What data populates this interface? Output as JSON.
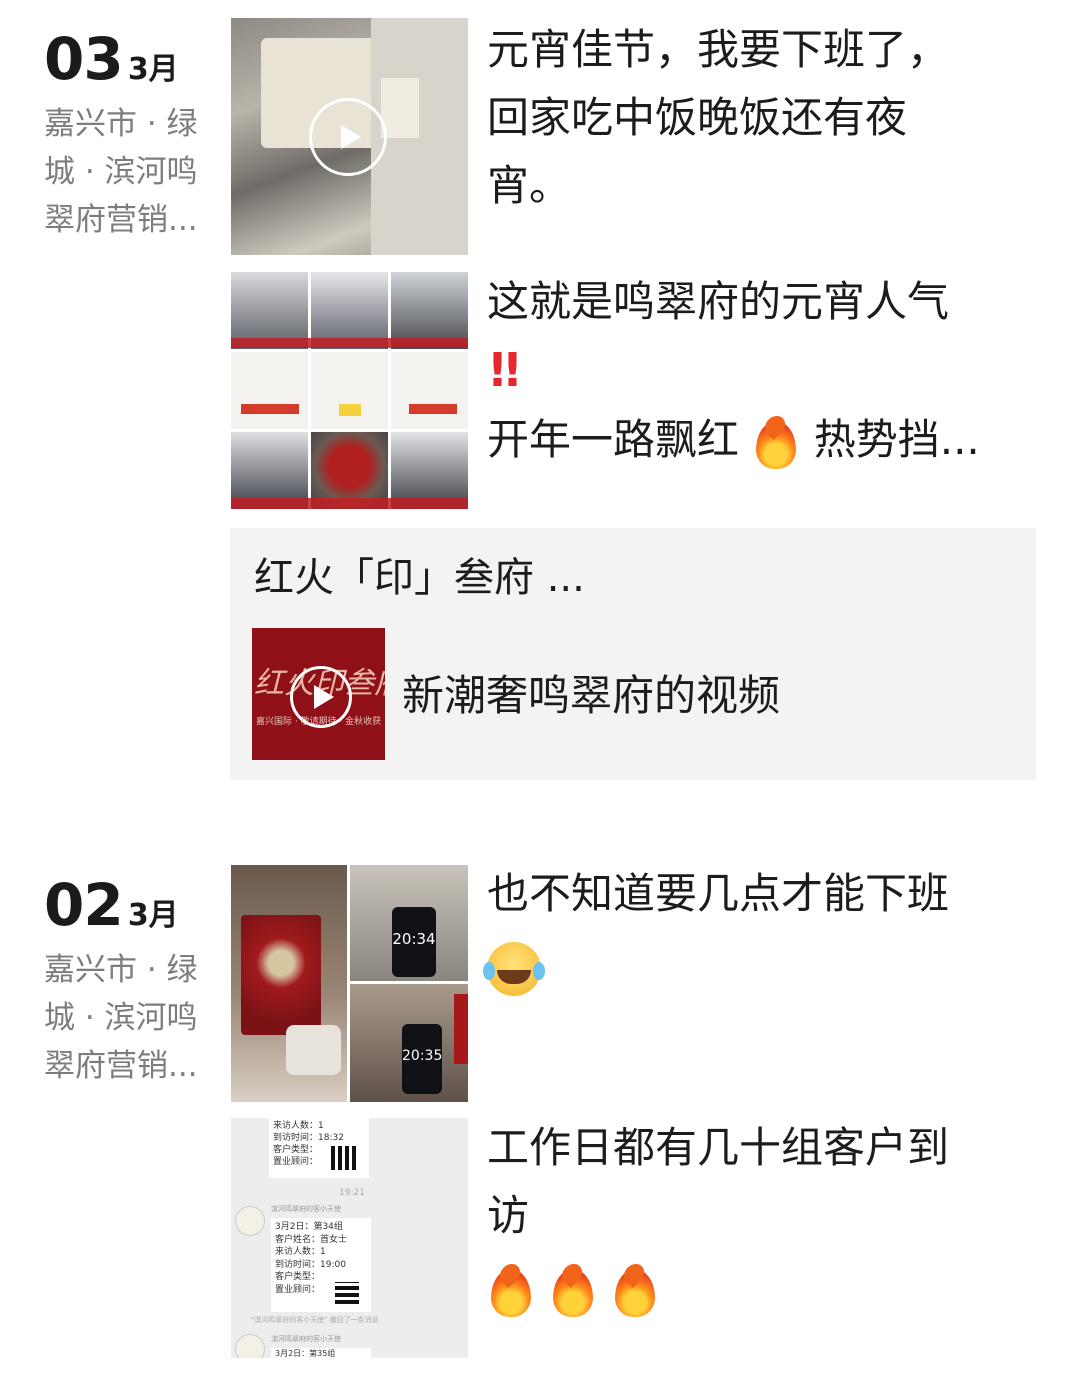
{
  "posts": [
    {
      "day": "03",
      "month": "3月",
      "location": [
        "嘉兴市 · 绿",
        "城 · 滨河鸣",
        "翠府营销..."
      ],
      "entries": [
        {
          "kind": "video",
          "text_lines": [
            "元宵佳节，我要下班了，",
            "回家吃中饭晚饭还有夜",
            "宵。"
          ]
        },
        {
          "kind": "grid9",
          "text_lines": [
            "这就是鸣翠府的元宵人气",
            "",
            "开年一路飘红",
            "热势挡..."
          ]
        }
      ],
      "share": {
        "title": "红火「印」叁府 ...",
        "thumb_text": "红火印叁府",
        "thumb_sub": "嘉兴国际 · 敬请期待 · 金秋收获",
        "source": "新潮奢鸣翠府的视频"
      }
    },
    {
      "day": "02",
      "month": "3月",
      "location": [
        "嘉兴市 · 绿",
        "城 · 滨河鸣",
        "翠府营销..."
      ],
      "entries": [
        {
          "kind": "grid3",
          "text_lines": [
            "也不知道要几点才能下班",
            ""
          ],
          "clock1": "20:34",
          "clock2": "20:35"
        },
        {
          "kind": "chat",
          "text_lines": [
            "工作日都有几十组客户到",
            "访",
            ""
          ],
          "chat": {
            "block1": [
              "来访人数：1",
              "到访时间：18:32",
              "客户类型：",
              "置业顾问："
            ],
            "time": "19:21",
            "sender": "滨河鸣翠府的客小天使",
            "block2": [
              "3月2日：第34组",
              "客户姓名：首女士",
              "来访人数：1",
              "到访时间：19:00",
              "客户类型：",
              "置业顾问："
            ],
            "footer": "\"滨河鸣翠府的客小天使\" 撤回了一条消息",
            "block3": "3月2日：第35组"
          }
        }
      ]
    }
  ]
}
